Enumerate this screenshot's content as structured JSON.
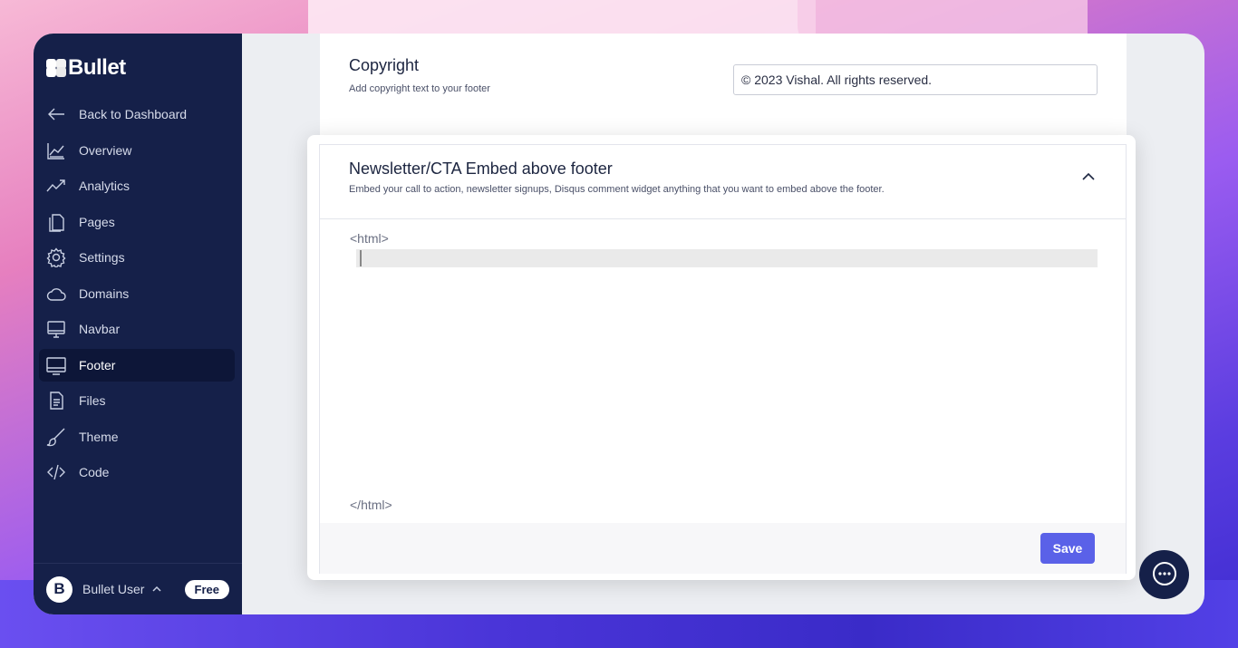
{
  "brand": {
    "name": "Bullet"
  },
  "sidebar": {
    "items": [
      {
        "label": "Back to Dashboard",
        "icon": "arrow-left-icon"
      },
      {
        "label": "Overview",
        "icon": "chart-area-icon"
      },
      {
        "label": "Analytics",
        "icon": "trend-line-icon"
      },
      {
        "label": "Pages",
        "icon": "file-icon"
      },
      {
        "label": "Settings",
        "icon": "gear-icon"
      },
      {
        "label": "Domains",
        "icon": "cloud-icon"
      },
      {
        "label": "Navbar",
        "icon": "monitor-icon"
      },
      {
        "label": "Footer",
        "icon": "monitor-footer-icon",
        "active": true
      },
      {
        "label": "Files",
        "icon": "document-icon"
      },
      {
        "label": "Theme",
        "icon": "brush-icon"
      },
      {
        "label": "Code",
        "icon": "code-icon"
      }
    ],
    "user": {
      "initial": "B",
      "name": "Bullet User",
      "plan": "Free"
    }
  },
  "copyright_card": {
    "title": "Copyright",
    "subtitle": "Add copyright text to your footer",
    "value": "© 2023 Vishal. All rights reserved."
  },
  "modal": {
    "title": "Newsletter/CTA Embed above footer",
    "subtitle": "Embed your call to action, newsletter signups, Disqus comment widget anything that you want to embed above the footer.",
    "code_open": "<html>",
    "code_close": "</html>",
    "code_value": "",
    "save_label": "Save"
  },
  "colors": {
    "sidebar_bg": "#152049",
    "accent": "#5a61e8"
  }
}
